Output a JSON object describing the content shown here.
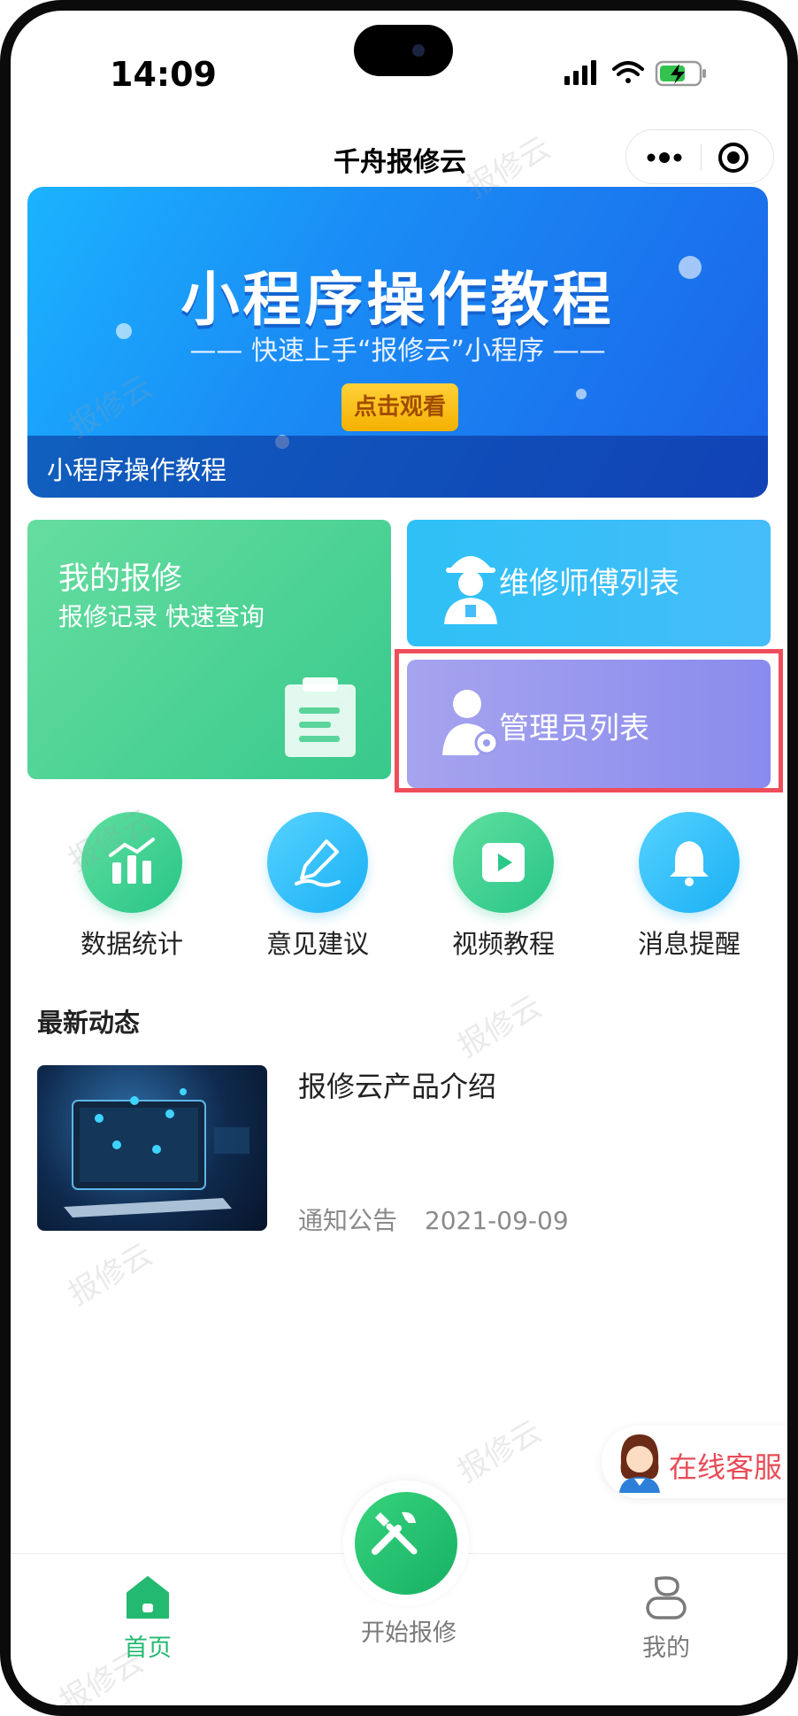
{
  "status_bar": {
    "time": "14:09"
  },
  "header": {
    "title": "千舟报修云",
    "more_icon": "more-dots-icon",
    "close_icon": "target-circle-icon"
  },
  "banner": {
    "title": "小程序操作教程",
    "subtitle": "—— 快速上手“报修云”小程序 ——",
    "button": "点击观看",
    "caption": "小程序操作教程"
  },
  "cards": {
    "my_repair": {
      "title": "我的报修",
      "subtitle": "报修记录 快速查询",
      "icon": "clipboard-icon"
    },
    "technicians": {
      "label": "维修师傅列表",
      "icon": "worker-icon"
    },
    "admins": {
      "label": "管理员列表",
      "icon": "admin-gear-icon"
    }
  },
  "quick_actions": [
    {
      "label": "数据统计",
      "icon": "bar-chart-icon",
      "color": "#28c587"
    },
    {
      "label": "意见建议",
      "icon": "pen-icon",
      "color": "#19b0f5"
    },
    {
      "label": "视频教程",
      "icon": "play-icon",
      "color": "#28c587"
    },
    {
      "label": "消息提醒",
      "icon": "bell-icon",
      "color": "#19b0f5"
    }
  ],
  "news": {
    "section_title": "最新动态",
    "items": [
      {
        "title": "报修云产品介绍",
        "category": "通知公告",
        "date": "2021-09-09"
      }
    ]
  },
  "customer_service": {
    "label": "在线客服"
  },
  "tabbar": {
    "items": [
      {
        "label": "首页",
        "icon": "home-icon",
        "active": true
      },
      {
        "label": "开始报修",
        "icon": "tools-icon",
        "active": false
      },
      {
        "label": "我的",
        "icon": "profile-icon",
        "active": false
      }
    ]
  },
  "watermark": {
    "text": "报修云"
  },
  "colors": {
    "accent_green": "#23b970",
    "highlight_red": "#ef4d5a",
    "service_red": "#e94b57"
  }
}
